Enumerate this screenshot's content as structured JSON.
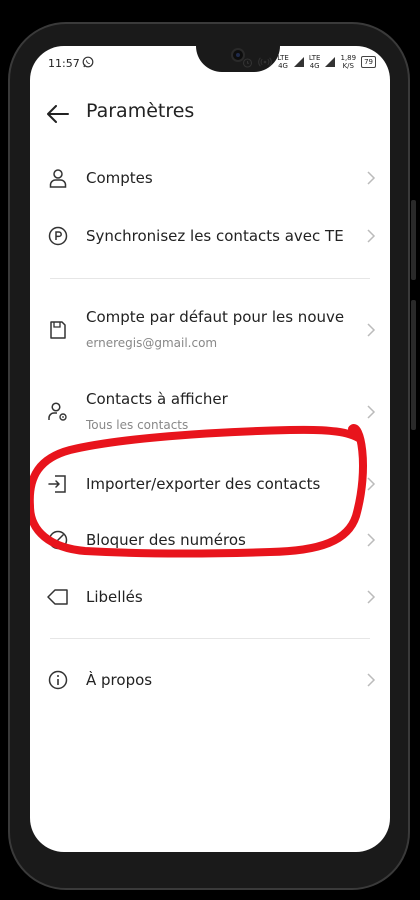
{
  "status_bar": {
    "time": "11:57",
    "network1_top": "LTE",
    "network1_bottom": "4G",
    "network2_top": "LTE",
    "network2_bottom": "4G",
    "speed_top": "1,89",
    "speed_bottom": "K/S",
    "battery": "79",
    "icons": [
      "whatsapp-icon",
      "alarm-icon",
      "hotspot-icon",
      "signal-icon",
      "battery-icon"
    ]
  },
  "header": {
    "title": "Paramètres",
    "back_icon": "arrow-left-icon"
  },
  "items": [
    {
      "label": "Comptes",
      "icon": "person-icon"
    },
    {
      "label": "Synchronisez les contacts avec TE",
      "icon": "sync-circle-icon"
    },
    {
      "label": "Compte par défaut pour les nouve",
      "sublabel": "erneregis@gmail.com",
      "icon": "save-icon"
    },
    {
      "label": "Contacts à afficher",
      "sublabel": "Tous les contacts",
      "icon": "person-view-icon"
    },
    {
      "label": "Importer/exporter des contacts",
      "icon": "import-icon"
    },
    {
      "label": "Bloquer des numéros",
      "icon": "block-icon"
    },
    {
      "label": "Libellés",
      "icon": "tag-icon"
    },
    {
      "label": "À propos",
      "icon": "info-icon"
    }
  ],
  "annotation": {
    "color": "#e8141c",
    "shape": "hand-drawn-ellipse"
  },
  "colors": {
    "text": "#222222",
    "muted": "#888888",
    "divider": "#e6e6e6",
    "chevron": "#bbbbbb"
  }
}
